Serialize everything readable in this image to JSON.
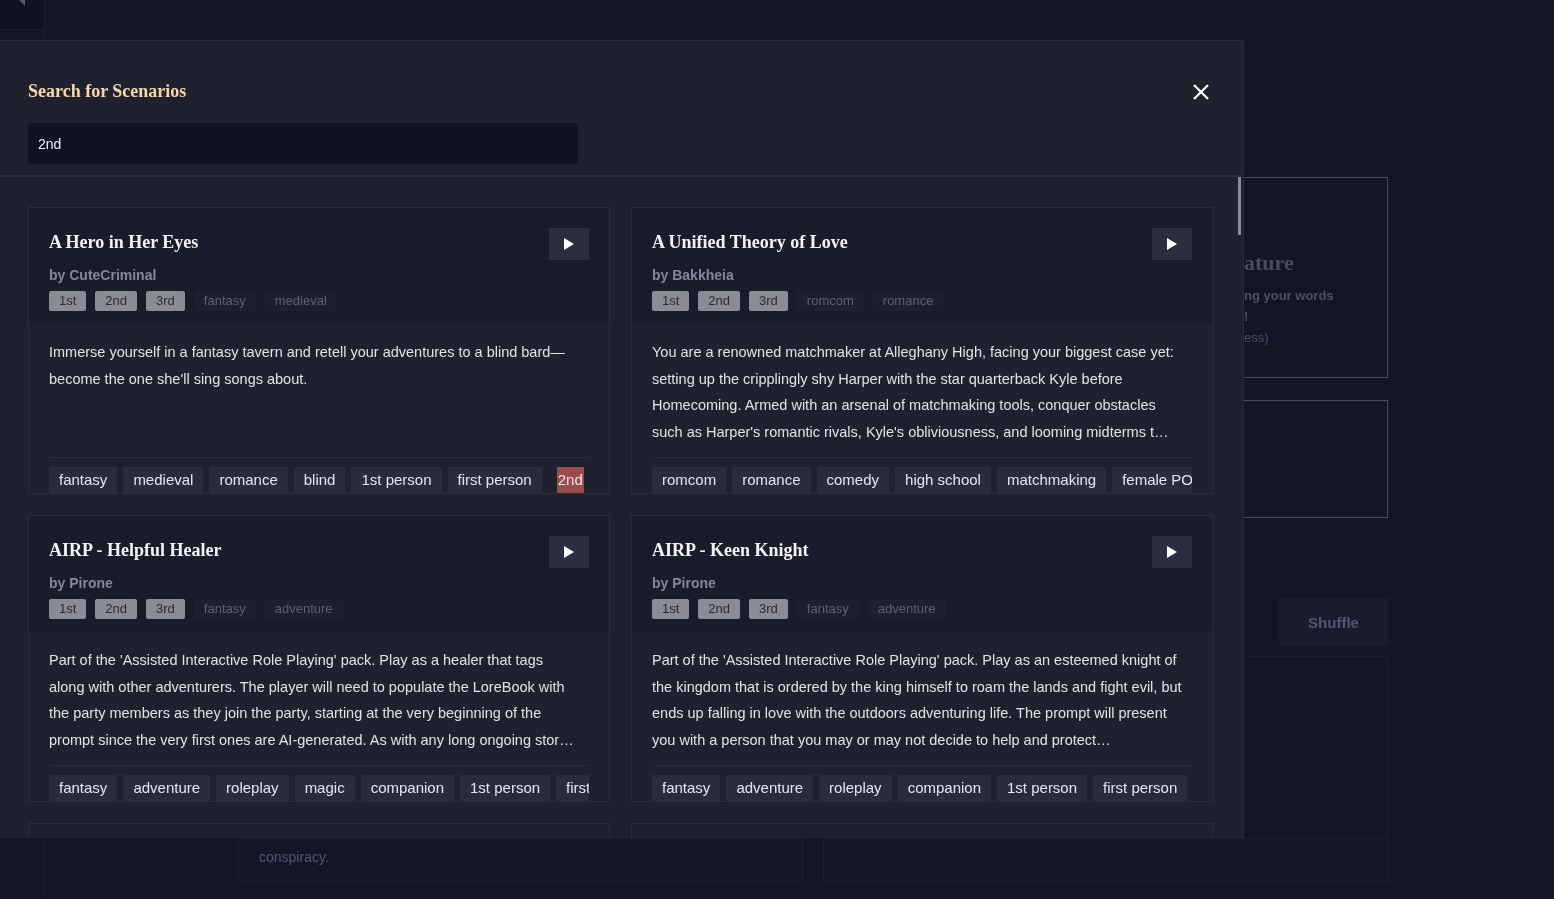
{
  "background": {
    "heading": "ature",
    "lines": [
      "ng your words",
      "!"
    ],
    "hint": "ess)",
    "shuffle_button": "Shuffle",
    "footer_text": "conspiracy."
  },
  "modal": {
    "title": "Search for Scenarios",
    "search": {
      "value": "2nd"
    },
    "cards": [
      {
        "title": "A Hero in Her Eyes",
        "author": "by CuteCriminal",
        "pronouns": [
          "1st",
          "2nd",
          "3rd"
        ],
        "genres": [
          "fantasy",
          "medieval"
        ],
        "description": "Immerse yourself in a fantasy tavern and retell your adventures to a blind bard—become the one she'll sing songs about.",
        "tags": [
          {
            "label": "fantasy",
            "highlighted": false
          },
          {
            "label": "medieval",
            "highlighted": false
          },
          {
            "label": "romance",
            "highlighted": false
          },
          {
            "label": "blind",
            "highlighted": false
          },
          {
            "label": "1st person",
            "highlighted": false
          },
          {
            "label": "first person",
            "highlighted": false
          },
          {
            "label": "2nd",
            "highlighted": true
          }
        ]
      },
      {
        "title": "A Unified Theory of Love",
        "author": "by Bakkheia",
        "pronouns": [
          "1st",
          "2nd",
          "3rd"
        ],
        "genres": [
          "romcom",
          "romance"
        ],
        "description": "You are a renowned matchmaker at Alleghany High, facing your biggest case yet: setting up the cripplingly shy Harper with the star quarterback Kyle before Homecoming. Armed with an arsenal of matchmaking tools, conquer obstacles such as Harper's romantic rivals, Kyle's obliviousness, and looming midterms t…",
        "tags": [
          {
            "label": "romcom",
            "highlighted": false
          },
          {
            "label": "romance",
            "highlighted": false
          },
          {
            "label": "comedy",
            "highlighted": false
          },
          {
            "label": "high school",
            "highlighted": false
          },
          {
            "label": "matchmaking",
            "highlighted": false
          },
          {
            "label": "female PO",
            "highlighted": false
          }
        ]
      },
      {
        "title": "AIRP - Helpful Healer",
        "author": "by Pirone",
        "pronouns": [
          "1st",
          "2nd",
          "3rd"
        ],
        "genres": [
          "fantasy",
          "adventure"
        ],
        "description": "Part of the 'Assisted Interactive Role Playing' pack. Play as a healer that tags along with other adventurers. The player will need to populate the LoreBook with the party members as they join the party, starting at the very beginning of the prompt since the very first ones are AI-generated. As with any long ongoing stor…",
        "tags": [
          {
            "label": "fantasy",
            "highlighted": false
          },
          {
            "label": "adventure",
            "highlighted": false
          },
          {
            "label": "roleplay",
            "highlighted": false
          },
          {
            "label": "magic",
            "highlighted": false
          },
          {
            "label": "companion",
            "highlighted": false
          },
          {
            "label": "1st person",
            "highlighted": false
          },
          {
            "label": "first",
            "highlighted": false
          }
        ]
      },
      {
        "title": "AIRP - Keen Knight",
        "author": "by Pirone",
        "pronouns": [
          "1st",
          "2nd",
          "3rd"
        ],
        "genres": [
          "fantasy",
          "adventure"
        ],
        "description": "Part of the 'Assisted Interactive Role Playing' pack. Play as an esteemed knight of the kingdom that is ordered by the king himself to roam the lands and fight evil, but ends up falling in love with the outdoors adventuring life. The prompt will present you with a person that you may or may not decide to help and protect…",
        "tags": [
          {
            "label": "fantasy",
            "highlighted": false
          },
          {
            "label": "adventure",
            "highlighted": false
          },
          {
            "label": "roleplay",
            "highlighted": false
          },
          {
            "label": "companion",
            "highlighted": false
          },
          {
            "label": "1st person",
            "highlighted": false
          },
          {
            "label": "first person",
            "highlighted": false
          }
        ]
      }
    ]
  }
}
